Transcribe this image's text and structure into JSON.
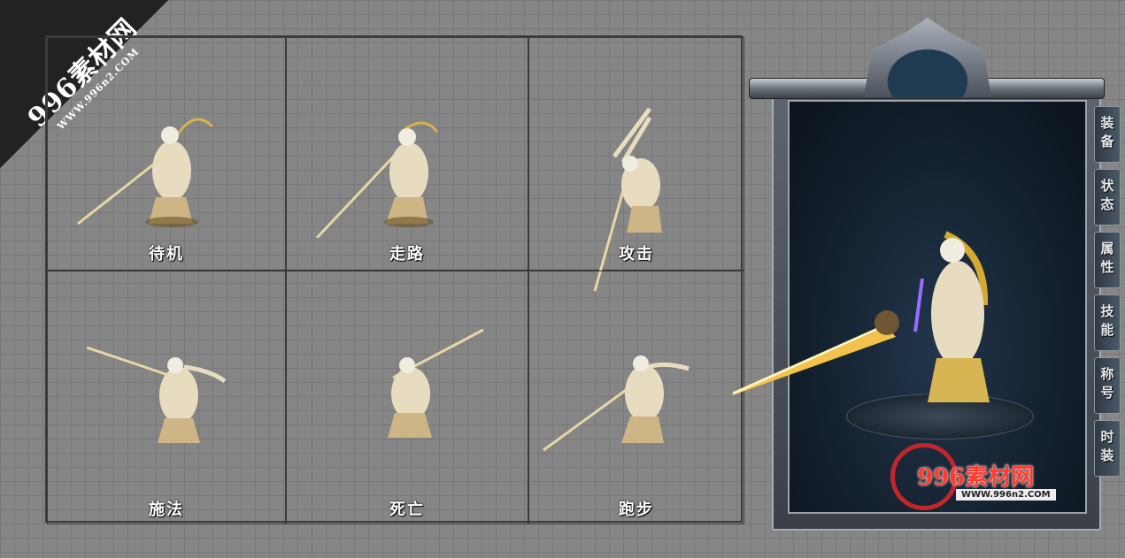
{
  "watermark": {
    "name": "996素材网",
    "url": "WWW.996n2.COM"
  },
  "actions": [
    {
      "label": "待机"
    },
    {
      "label": "走路"
    },
    {
      "label": "攻击"
    },
    {
      "label": "施法"
    },
    {
      "label": "死亡"
    },
    {
      "label": "跑步"
    }
  ],
  "panel": {
    "tabs": [
      "装备",
      "状态",
      "属性",
      "技能",
      "称号",
      "时装"
    ],
    "logo": {
      "title": "996素材网",
      "url": "WWW.996n2.COM"
    }
  },
  "colors": {
    "gold": "#d9b24a",
    "robe": "#e8dcc0",
    "screen": "#14212f",
    "logo_red": "#c0262a"
  }
}
